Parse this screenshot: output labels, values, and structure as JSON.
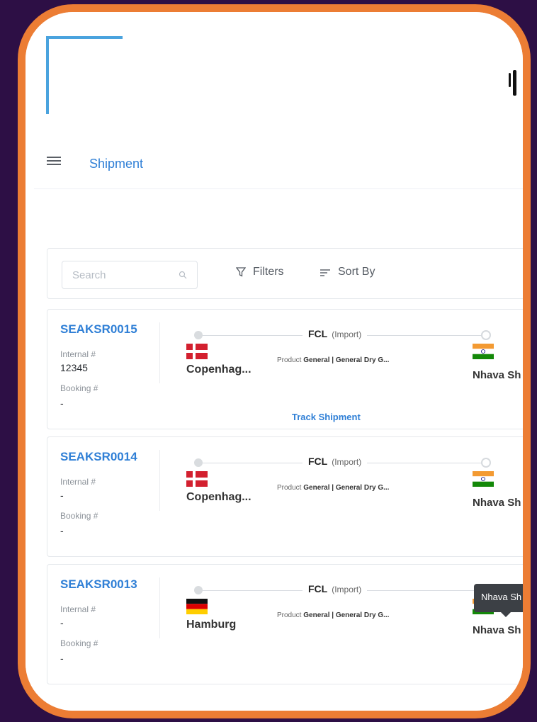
{
  "colors": {
    "accent": "#2f7fd6",
    "frame": "#ec7d34",
    "background": "#2d0f45"
  },
  "nav": {
    "title": "Shipment"
  },
  "toolbar": {
    "search_placeholder": "Search",
    "filters_label": "Filters",
    "sort_label": "Sort By"
  },
  "cards": [
    {
      "id": "SEAKSR0015",
      "internal_label": "Internal #",
      "internal_value": "12345",
      "booking_label": "Booking #",
      "booking_value": "-",
      "mode": "FCL",
      "mode_sub": "(Import)",
      "product_prefix": "Product",
      "product_value": "General | General Dry G...",
      "origin": "Copenhag...",
      "origin_flag": "denmark-flag-icon",
      "destination": "Nhava Sh",
      "destination_flag": "india-flag-icon",
      "track_label": "Track Shipment"
    },
    {
      "id": "SEAKSR0014",
      "internal_label": "Internal #",
      "internal_value": "-",
      "booking_label": "Booking #",
      "booking_value": "-",
      "mode": "FCL",
      "mode_sub": "(Import)",
      "product_prefix": "Product",
      "product_value": "General | General Dry G...",
      "origin": "Copenhag...",
      "origin_flag": "denmark-flag-icon",
      "destination": "Nhava Sh",
      "destination_flag": "india-flag-icon"
    },
    {
      "id": "SEAKSR0013",
      "internal_label": "Internal #",
      "internal_value": "-",
      "booking_label": "Booking #",
      "booking_value": "-",
      "mode": "FCL",
      "mode_sub": "(Import)",
      "product_prefix": "Product",
      "product_value": "General | General Dry G...",
      "origin": "Hamburg",
      "origin_flag": "germany-flag-icon",
      "destination": "Nhava Sh",
      "destination_flag": "india-flag-icon"
    }
  ],
  "tooltip": {
    "text": "Nhava Sh"
  }
}
